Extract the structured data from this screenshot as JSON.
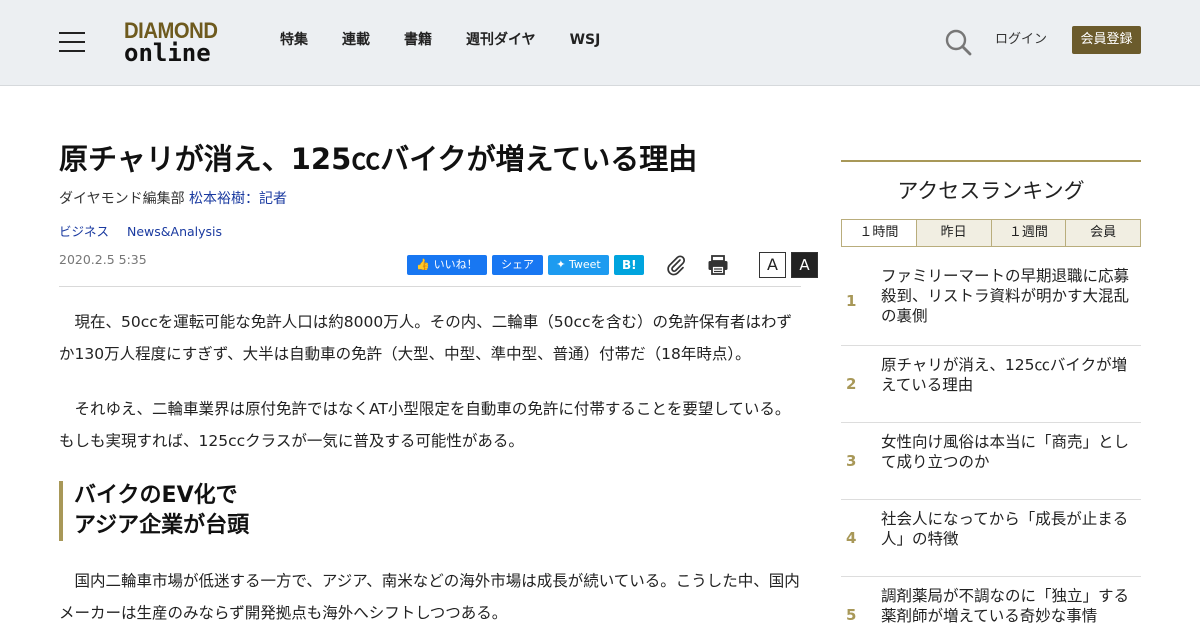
{
  "header": {
    "logo_top": "DIAMOND",
    "logo_bottom": "online",
    "nav": [
      "特集",
      "連載",
      "書籍",
      "週刊ダイヤ",
      "WSJ"
    ],
    "login": "ログイン",
    "register": "会員登録"
  },
  "article": {
    "title": "原チャリが消え、125㏄バイクが増えている理由",
    "byline_prefix": "ダイヤモンド編集部 ",
    "author": "松本裕樹：記者",
    "tags": [
      "ビジネス",
      "News&Analysis"
    ],
    "date": "2020.2.5 5:35",
    "share": {
      "like": "いいね！",
      "share": "シェア",
      "tweet": "Tweet",
      "hatena": "B!"
    },
    "font_small": "A",
    "font_large": "A",
    "paragraph1": "　現在、50ccを運転可能な免許人口は約8000万人。その内、二輪車（50ccを含む）の免許保有者はわずか130万人程度にすぎず、大半は自動車の免許（大型、中型、準中型、普通）付帯だ（18年時点）。",
    "paragraph2": "　それゆえ、二輪車業界は原付免許ではなくAT小型限定を自動車の免許に付帯することを要望している。もしも実現すれば、125ccクラスが一気に普及する可能性がある。",
    "subheading_line1": "バイクのEV化で",
    "subheading_line2": "アジア企業が台頭",
    "paragraph3": "　国内二輪車市場が低迷する一方で、アジア、南米などの海外市場は成長が続いている。こうした中、国内メーカーは生産のみならず開発拠点も海外へシフトしつつある。"
  },
  "ranking": {
    "title": "アクセスランキング",
    "tabs": [
      "１時間",
      "昨日",
      "１週間",
      "会員"
    ],
    "items": [
      {
        "rank": "1",
        "text": "ファミリーマートの早期退職に応募殺到、リストラ資料が明かす大混乱の裏側"
      },
      {
        "rank": "2",
        "text": "原チャリが消え、125㏄バイクが増えている理由"
      },
      {
        "rank": "3",
        "text": "女性向け風俗は本当に「商売」として成り立つのか"
      },
      {
        "rank": "4",
        "text": "社会人になってから「成長が止まる人」の特徴"
      },
      {
        "rank": "5",
        "text": "調剤薬局が不調なのに「独立」する薬剤師が増えている奇妙な事情"
      }
    ]
  }
}
